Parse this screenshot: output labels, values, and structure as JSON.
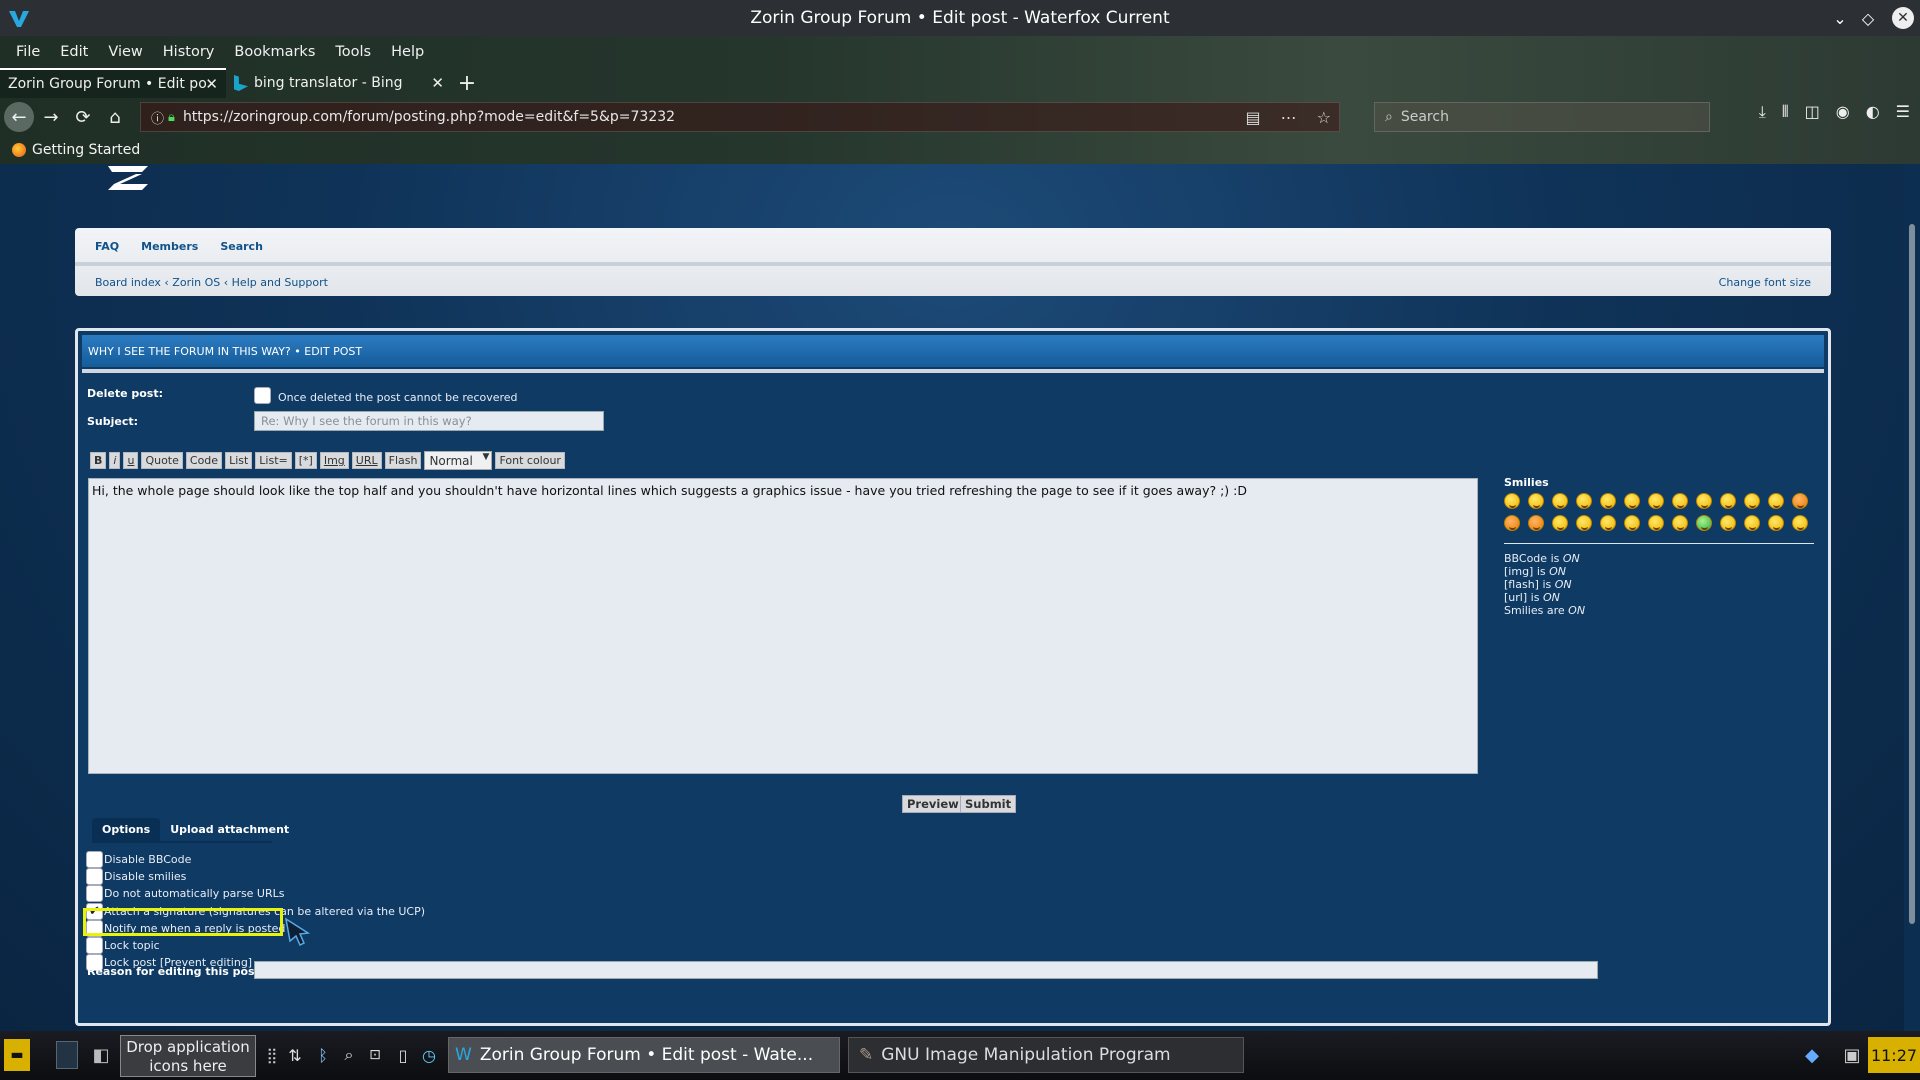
{
  "window": {
    "title": "Zorin Group Forum • Edit post - Waterfox Current"
  },
  "menu": [
    "File",
    "Edit",
    "View",
    "History",
    "Bookmarks",
    "Tools",
    "Help"
  ],
  "tabs": [
    {
      "label": "Zorin Group Forum • Edit po",
      "active": true
    },
    {
      "label": "bing translator - Bing",
      "active": false
    }
  ],
  "navbar": {
    "url": "https://zoringroup.com/forum/posting.php?mode=edit&f=5&p=73232",
    "search_placeholder": "Search"
  },
  "bookmarks": [
    {
      "label": "Getting Started"
    }
  ],
  "forum": {
    "nav_links": [
      "FAQ",
      "Members",
      "Search"
    ],
    "breadcrumbs": "Board index ‹ Zorin OS ‹ Help and Support",
    "change_font_size": "Change font size",
    "panel_title": "WHY I SEE THE FORUM IN THIS WAY? • EDIT POST",
    "delete_label": "Delete post:",
    "delete_note": "Once deleted the post cannot be recovered",
    "subject_label": "Subject:",
    "subject_value": "Re: Why I see the forum in this way?",
    "bbcode_buttons": [
      "B",
      "i",
      "u",
      "Quote",
      "Code",
      "List",
      "List=",
      "[*]",
      "Img",
      "URL",
      "Flash"
    ],
    "font_size_select": "Normal",
    "font_colour_button": "Font colour",
    "message": "Hi, the whole page should look like the top half and you shouldn't have horizontal lines which suggests a graphics issue - have you tried refreshing the page to see if it goes away?  ;)  :D",
    "smilies_label": "Smilies",
    "smiley_count": 26,
    "bbcode_status": [
      {
        "name": "BBCode",
        "verb": "is",
        "state": "ON"
      },
      {
        "name": "[img]",
        "verb": "is",
        "state": "ON"
      },
      {
        "name": "[flash]",
        "verb": "is",
        "state": "ON"
      },
      {
        "name": "[url]",
        "verb": "is",
        "state": "ON"
      },
      {
        "name": "Smilies",
        "verb": "are",
        "state": "ON"
      }
    ],
    "preview_button": "Preview",
    "submit_button": "Submit",
    "option_tabs": [
      "Options",
      "Upload attachment"
    ],
    "options": [
      {
        "label": "Disable BBCode",
        "checked": false
      },
      {
        "label": "Disable smilies",
        "checked": false
      },
      {
        "label": "Do not automatically parse URLs",
        "checked": false
      },
      {
        "label": "Attach a signature (signatures can be altered via the UCP)",
        "checked": true
      },
      {
        "label": "Notify me when a reply is posted",
        "checked": false
      },
      {
        "label": "Lock topic",
        "checked": false
      },
      {
        "label": "Lock post [Prevent editing]",
        "checked": false
      }
    ],
    "reason_label": "Reason for editing this post:",
    "reason_value": ""
  },
  "taskbar": {
    "drop_text": "Drop application icons here",
    "tasks": [
      {
        "label": "Zorin Group Forum • Edit post - Wate...",
        "active": true
      },
      {
        "label": "GNU Image Manipulation Program",
        "active": false
      }
    ],
    "clock": "11:27"
  },
  "colors": {
    "highlight": "#e9f20a",
    "link": "#105289",
    "panel_head": "#2c7cc2"
  }
}
